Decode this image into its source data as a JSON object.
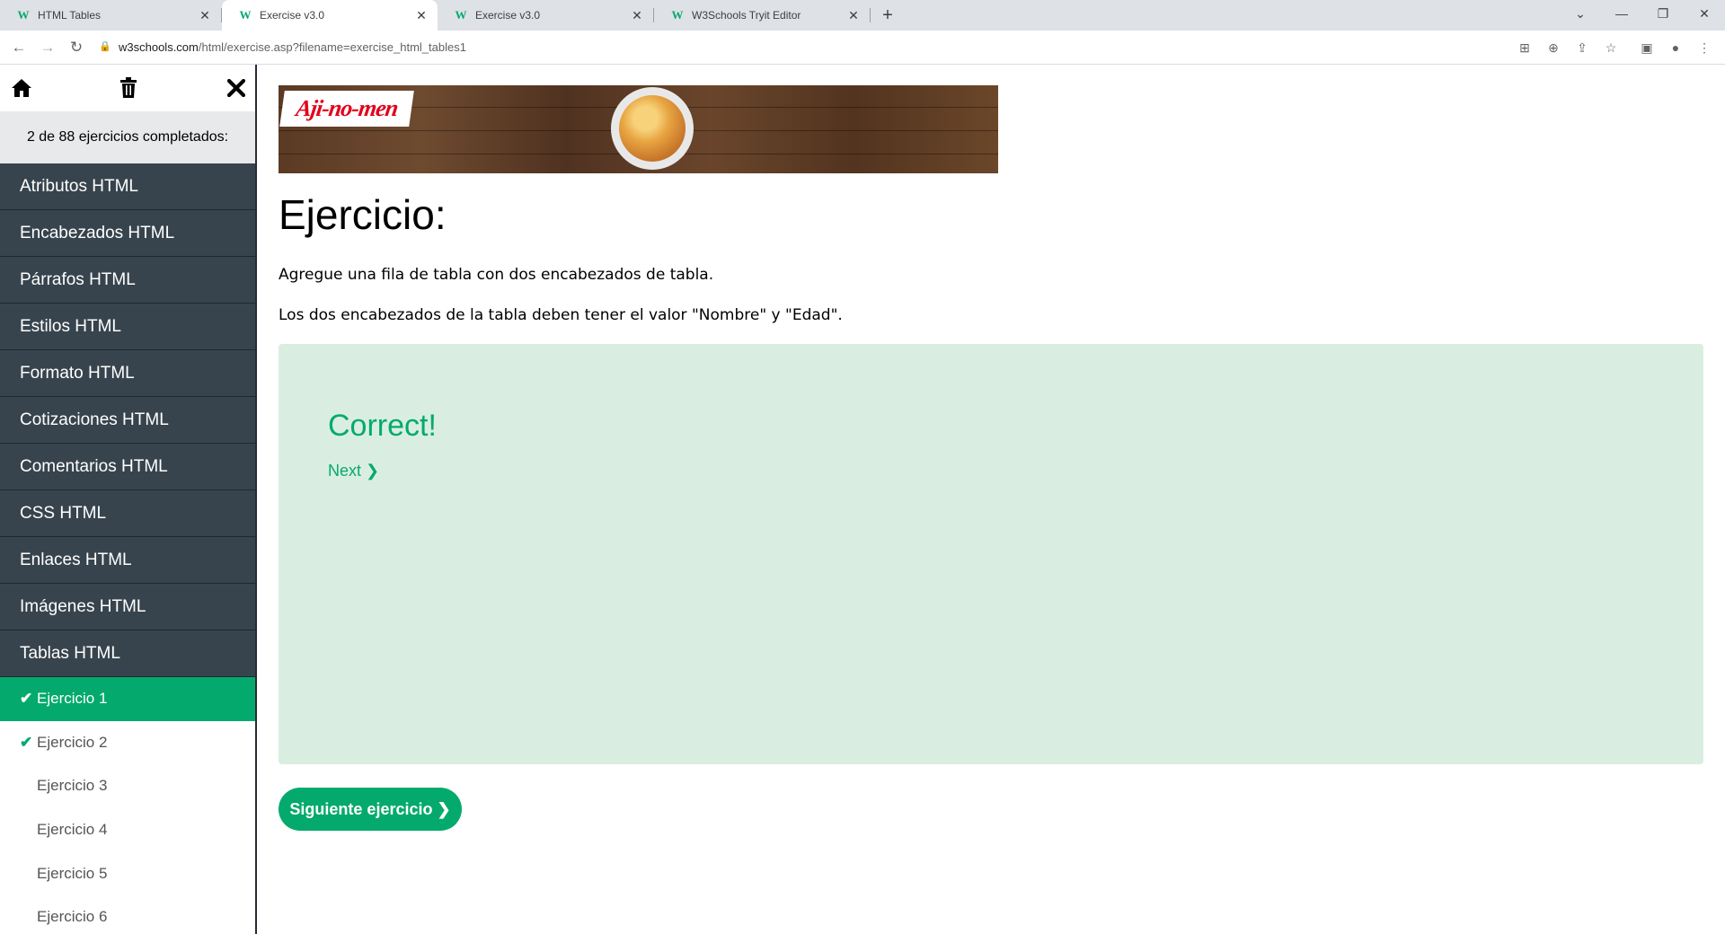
{
  "browser": {
    "tabs": [
      {
        "title": "HTML Tables"
      },
      {
        "title": "Exercise v3.0"
      },
      {
        "title": "Exercise v3.0"
      },
      {
        "title": "W3Schools Tryit Editor"
      }
    ],
    "url_host": "w3schools.com",
    "url_path": "/html/exercise.asp?filename=exercise_html_tables1"
  },
  "sidebar": {
    "progress_text": "2 de 88 ejercicios completados:",
    "categories": [
      "Atributos HTML",
      "Encabezados HTML",
      "Párrafos HTML",
      "Estilos HTML",
      "Formato HTML",
      "Cotizaciones HTML",
      "Comentarios HTML",
      "CSS HTML",
      "Enlaces HTML",
      "Imágenes HTML",
      "Tablas HTML"
    ],
    "exercises": [
      {
        "label": "Ejercicio 1",
        "done": true
      },
      {
        "label": "Ejercicio 2",
        "done": true
      },
      {
        "label": "Ejercicio 3",
        "done": false
      },
      {
        "label": "Ejercicio 4",
        "done": false
      },
      {
        "label": "Ejercicio 5",
        "done": false
      },
      {
        "label": "Ejercicio 6",
        "done": false
      }
    ]
  },
  "ad": {
    "brand": "Aji-no-men"
  },
  "main": {
    "heading": "Ejercicio:",
    "instruction_1": "Agregue una fila de tabla con dos encabezados de tabla.",
    "instruction_2": "Los dos encabezados de la tabla deben tener el valor \"Nombre\" y \"Edad\".",
    "result_title": "Correct!",
    "next_link": "Next ❯",
    "next_button": "Siguiente ejercicio ❯"
  },
  "colors": {
    "accent": "#04aa6d",
    "sidebar_dark": "#38444d",
    "result_bg": "#d9eee1"
  }
}
